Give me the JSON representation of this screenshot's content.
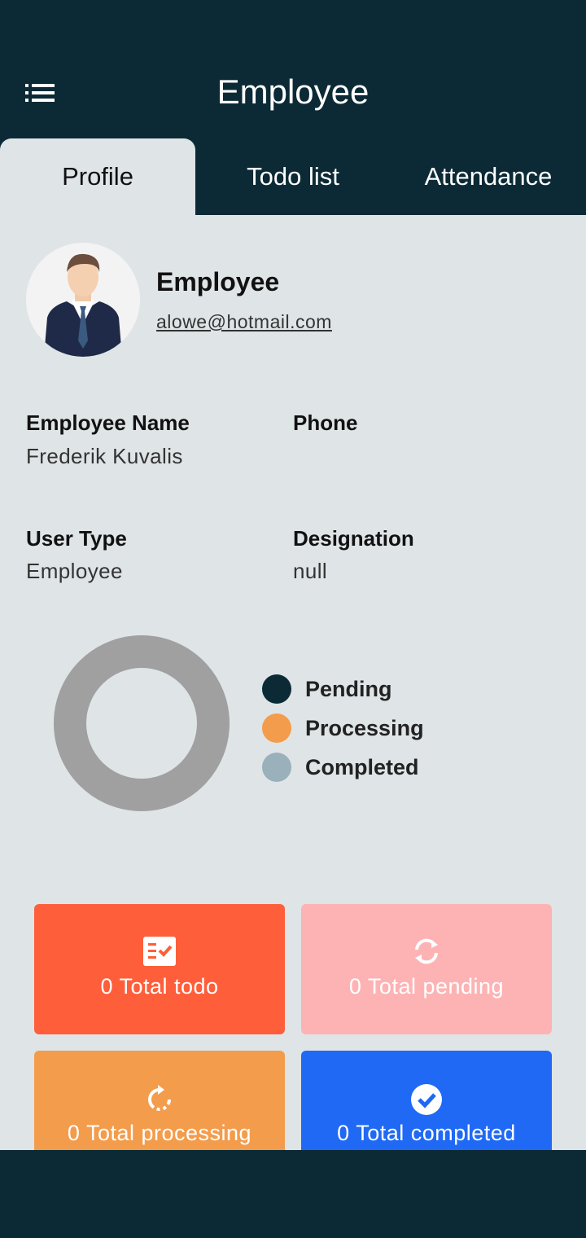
{
  "appbar": {
    "title": "Employee",
    "menu_icon": "menu-icon"
  },
  "tabs": [
    {
      "label": "Profile",
      "active": true
    },
    {
      "label": "Todo list",
      "active": false
    },
    {
      "label": "Attendance",
      "active": false
    }
  ],
  "profile": {
    "name": "Employee",
    "email": "alowe@hotmail.com"
  },
  "details": {
    "employee_name_label": "Employee Name",
    "employee_name_value": "Frederik Kuvalis",
    "phone_label": "Phone",
    "phone_value": "",
    "user_type_label": "User Type",
    "user_type_value": "Employee",
    "designation_label": "Designation",
    "designation_value": "null"
  },
  "chart_data": {
    "type": "pie",
    "categories": [
      "Pending",
      "Processing",
      "Completed"
    ],
    "values": [
      0,
      0,
      0
    ],
    "colors": [
      "#0b2a35",
      "#f39c4b",
      "#9ab0ba"
    ],
    "empty_color": "#a0a0a0",
    "legend_position": "right"
  },
  "cards": [
    {
      "label": "0 Total todo",
      "icon": "todo-list-icon",
      "color": "#ff5e3a"
    },
    {
      "label": "0 Total pending",
      "icon": "sync-icon",
      "color": "#fdb3b4"
    },
    {
      "label": "0 Total processing",
      "icon": "rotate-icon",
      "color": "#f39c4b"
    },
    {
      "label": "0 Total completed",
      "icon": "check-circle-icon",
      "color": "#1f69f5"
    }
  ]
}
